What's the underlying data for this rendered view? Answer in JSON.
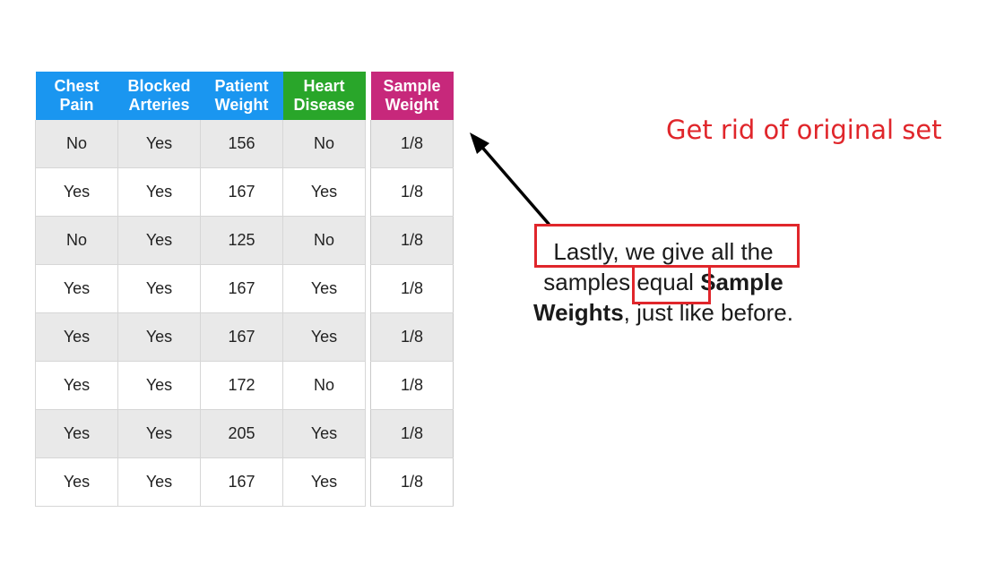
{
  "table": {
    "headers": [
      {
        "line1": "Chest",
        "line2": "Pain",
        "color": "#1a96f0"
      },
      {
        "line1": "Blocked",
        "line2": "Arteries",
        "color": "#1a96f0"
      },
      {
        "line1": "Patient",
        "line2": "Weight",
        "color": "#1a96f0"
      },
      {
        "line1": "Heart",
        "line2": "Disease",
        "color": "#29a62a"
      }
    ],
    "rows": [
      [
        "No",
        "Yes",
        "156",
        "No"
      ],
      [
        "Yes",
        "Yes",
        "167",
        "Yes"
      ],
      [
        "No",
        "Yes",
        "125",
        "No"
      ],
      [
        "Yes",
        "Yes",
        "167",
        "Yes"
      ],
      [
        "Yes",
        "Yes",
        "167",
        "Yes"
      ],
      [
        "Yes",
        "Yes",
        "172",
        "No"
      ],
      [
        "Yes",
        "Yes",
        "205",
        "Yes"
      ],
      [
        "Yes",
        "Yes",
        "167",
        "Yes"
      ]
    ]
  },
  "weights": {
    "header": {
      "line1": "Sample",
      "line2": "Weight",
      "color": "#c7287b"
    },
    "values": [
      "1/8",
      "1/8",
      "1/8",
      "1/8",
      "1/8",
      "1/8",
      "1/8",
      "1/8"
    ]
  },
  "narration": {
    "line1": "Lastly, we give all the",
    "line2_start": "samples ",
    "line2_equal": "equal",
    "line2_bold": " Sample",
    "line3_bold": "Weights",
    "line3_end": ", just like before."
  },
  "annotation": {
    "note": "Get rid of original set",
    "color": "#e0262b"
  }
}
